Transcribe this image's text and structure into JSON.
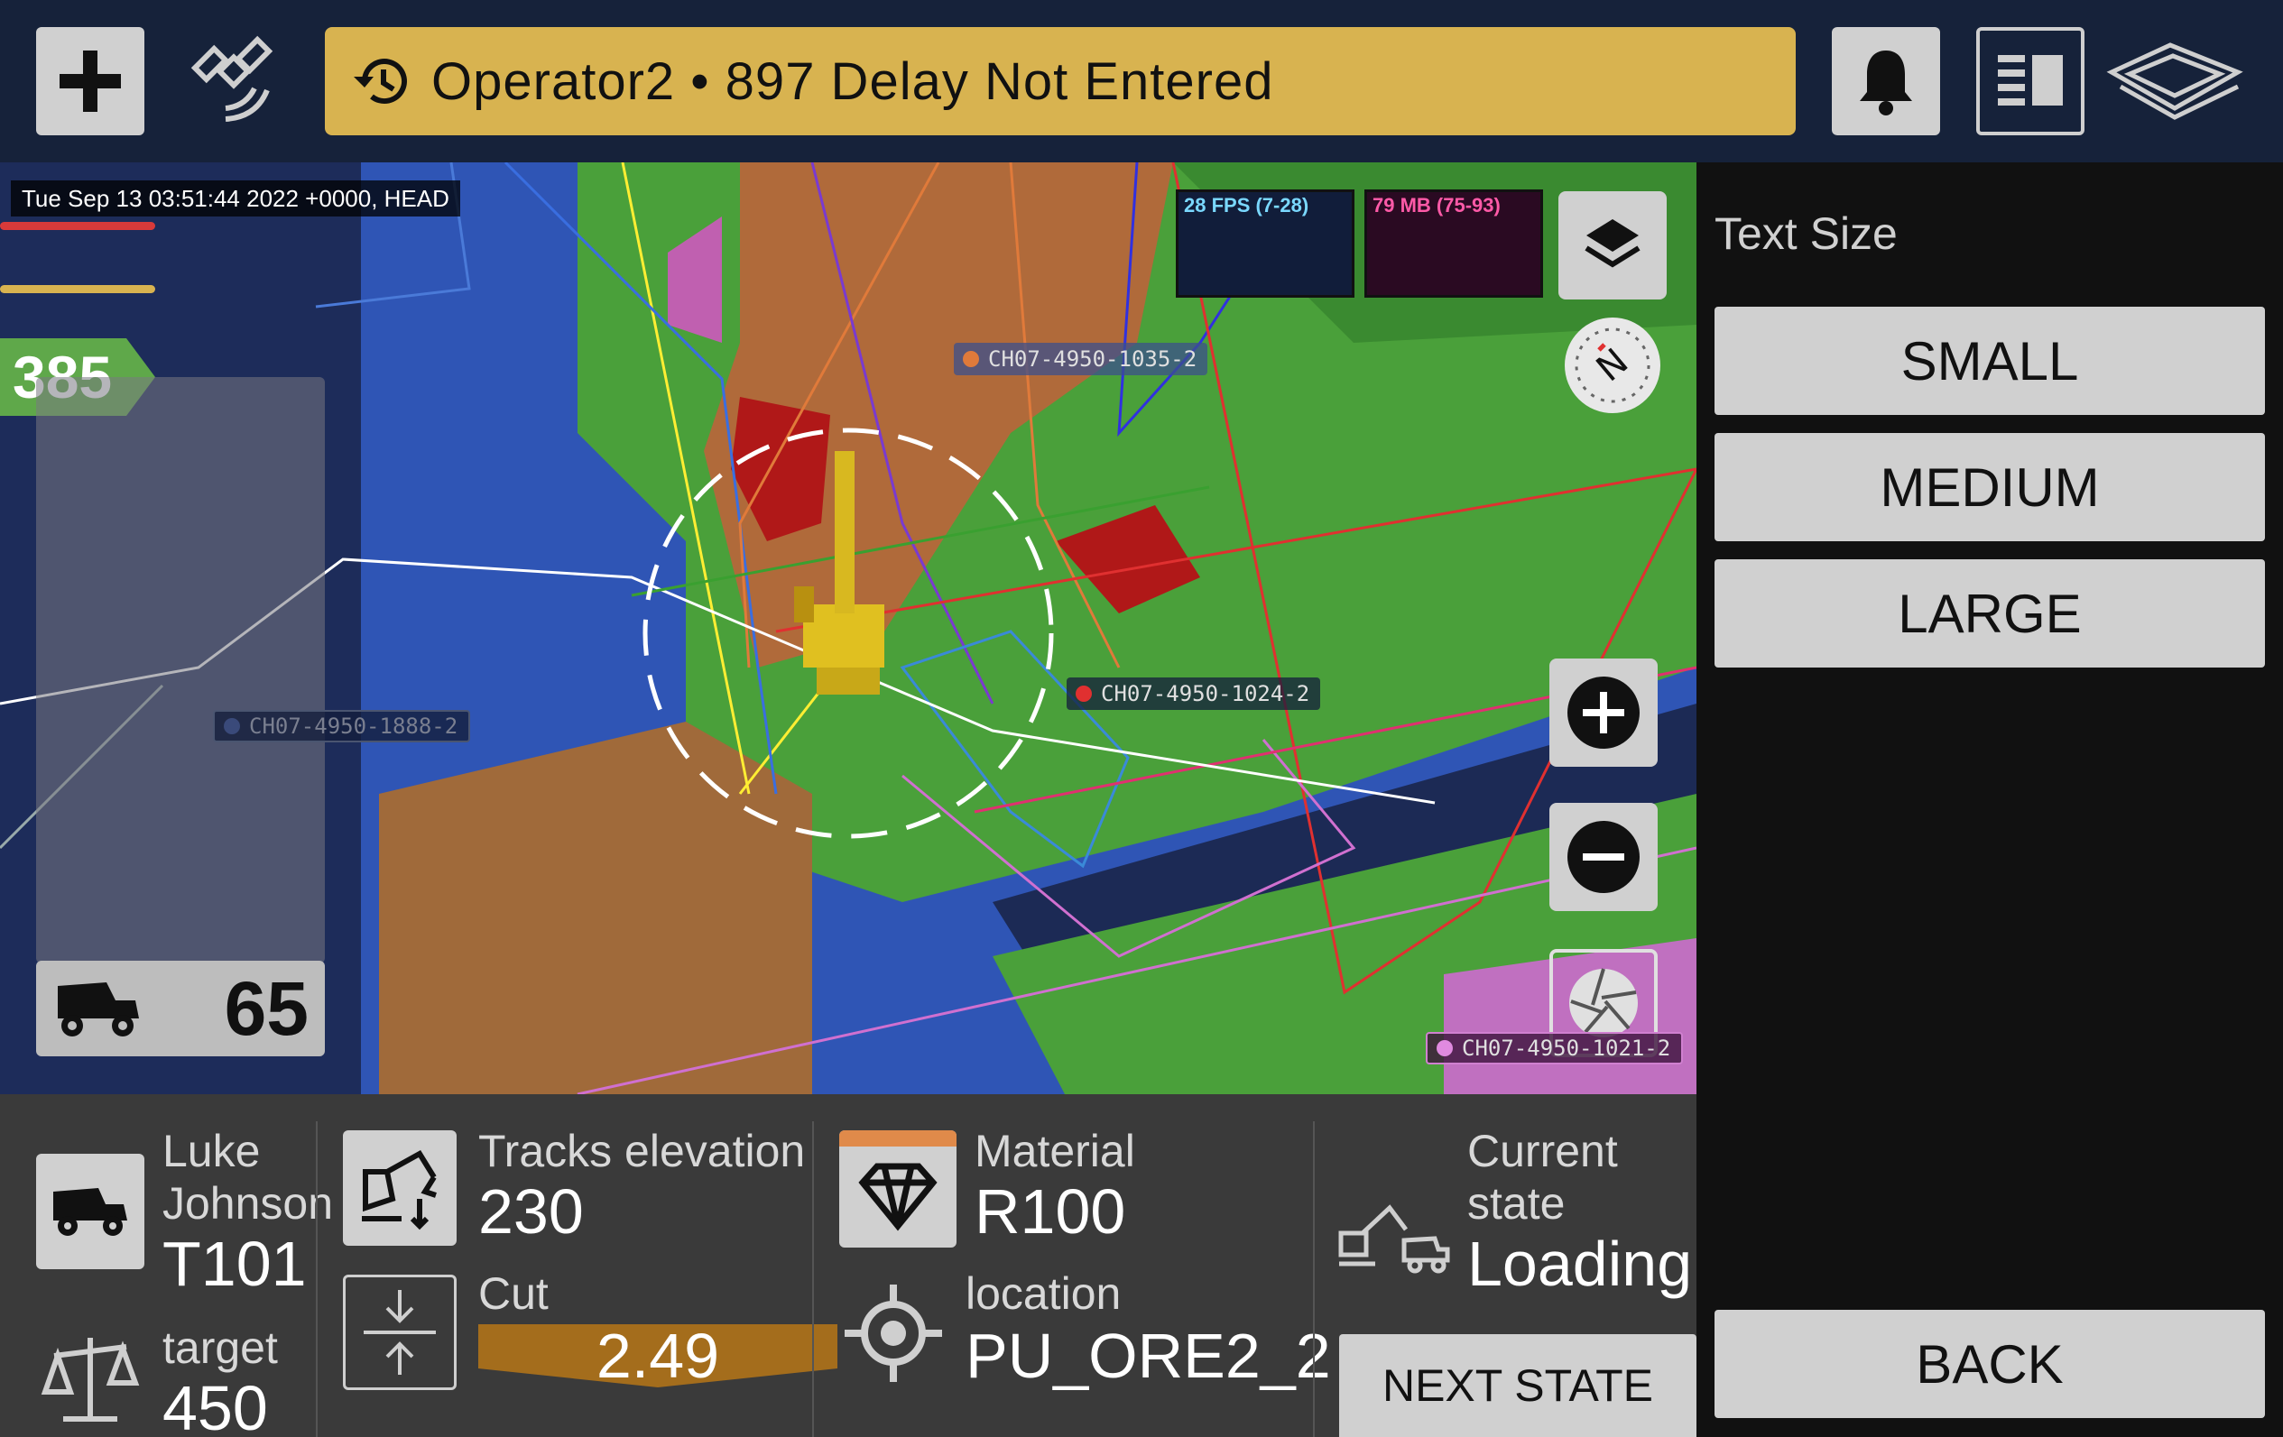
{
  "topbar": {
    "add_icon": "plus-icon",
    "satellite_icon": "satellite-icon",
    "history_icon": "history-icon",
    "alert_text": "Operator2 • 897 Delay Not Entered",
    "bell_icon": "bell-icon",
    "layout_icon": "layout-icon",
    "logo_icon": "brand-logo-icon"
  },
  "map": {
    "timestamp": "Tue Sep 13 03:51:44 2022 +0000, HEAD",
    "counter": "385",
    "truck_count": "65",
    "fps": "28 FPS (7-28)",
    "mem": "79 MB (75-93)",
    "labels": {
      "top": "CH07-4950-1035-2",
      "mid": "CH07-4950-1024-2",
      "left": "CH07-4950-1888-2",
      "bottom": "CH07-4950-1021-2"
    },
    "colors": {
      "top_dot": "#e07a3a",
      "mid_dot": "#e03030",
      "left_dot": "#3a4a7a",
      "bottom_dot": "#e08ae0"
    }
  },
  "bottom": {
    "operator_first": "Luke",
    "operator_last": "Johnson",
    "truck_id": "T101",
    "target_label": "target",
    "target_value": "450",
    "tracks_label": "Tracks elevation",
    "tracks_value": "230",
    "cut_label": "Cut",
    "cut_value": "2.49",
    "material_label": "Material",
    "material_value": "R100",
    "location_label": "location",
    "location_value": "PU_ORE2_2",
    "state_label_1": "Current",
    "state_label_2": "state",
    "state_value": "Loading",
    "next_state": "NEXT STATE"
  },
  "right": {
    "title": "Text Size",
    "small": "SMALL",
    "medium": "MEDIUM",
    "large": "LARGE",
    "back": "BACK"
  }
}
